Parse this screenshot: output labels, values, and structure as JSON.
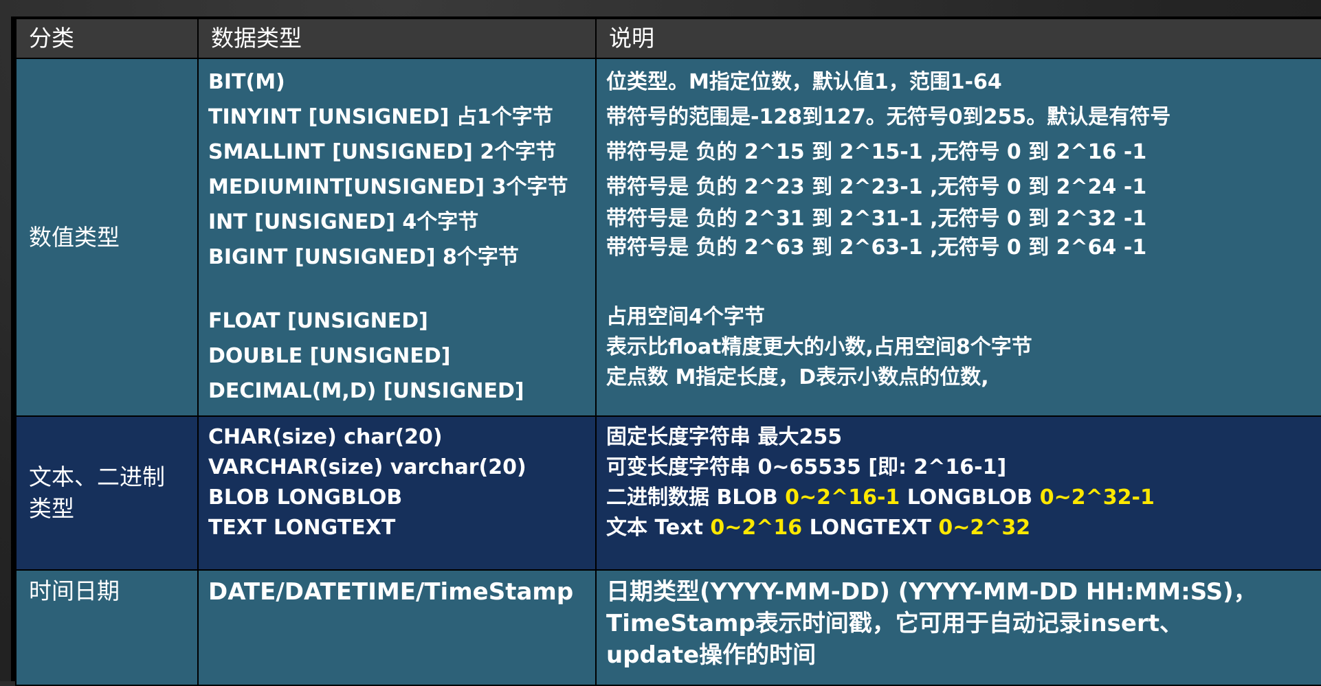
{
  "header": {
    "col_category": "分类",
    "col_type": "数据类型",
    "col_desc": "说明"
  },
  "numeric": {
    "category": "数值类型",
    "types": [
      "BIT(M)",
      "TINYINT [UNSIGNED]   占1个字节",
      "SMALLINT [UNSIGNED]  2个字节",
      "MEDIUMINT[UNSIGNED] 3个字节",
      "INT [UNSIGNED]  4个字节",
      "BIGINT [UNSIGNED] 8个字节",
      "FLOAT [UNSIGNED]",
      "DOUBLE [UNSIGNED]",
      "DECIMAL(M,D) [UNSIGNED]"
    ],
    "descs": [
      "位类型。M指定位数，默认值1，范围1-64",
      "带符号的范围是-128到127。无符号0到255。默认是有符号",
      "带符号是  负的 2^15 到 2^15-1 ,无符号 0 到 2^16 -1",
      "带符号是  负的 2^23 到 2^23-1 ,无符号 0 到 2^24 -1",
      "带符号是  负的 2^31 到 2^31-1 ,无符号 0 到 2^32 -1",
      "带符号是  负的 2^63 到 2^63-1 ,无符号 0 到 2^64 -1",
      "占用空间4个字节",
      "表示比float精度更大的小数,占用空间8个字节",
      "定点数 M指定长度，D表示小数点的位数,"
    ]
  },
  "text": {
    "category": "文本、二进制类型",
    "types": [
      "CHAR(size) char(20)",
      "VARCHAR(size)  varchar(20)",
      "BLOB   LONGBLOB",
      "TEXT   LONGTEXT"
    ],
    "desc1": "固定长度字符串 最大255",
    "desc2": "可变长度字符串 0~65535 [即: 2^16-1]",
    "desc3": {
      "p1": "二进制数据 BLOB ",
      "y1": "0~2^16-1",
      "p2": " LONGBLOB ",
      "y2": "0~2^32-1"
    },
    "desc4": {
      "p1": "文本 Text ",
      "y1": "0~2^16",
      "p2": " LONGTEXT ",
      "y2": "0~2^32"
    }
  },
  "datetime": {
    "category": "时间日期",
    "type": "DATE/DATETIME/TimeStamp",
    "desc": [
      "日期类型(YYYY-MM-DD)  (YYYY-MM-DD HH:MM:SS)，",
      "TimeStamp表示时间戳，它可用于自动记录insert、",
      "update操作的时间"
    ]
  },
  "colors": {
    "header_bg": "#3a3a3a",
    "numeric_bg": "#2d6178",
    "text_bg": "#16305b",
    "highlight": "#ffe800"
  }
}
